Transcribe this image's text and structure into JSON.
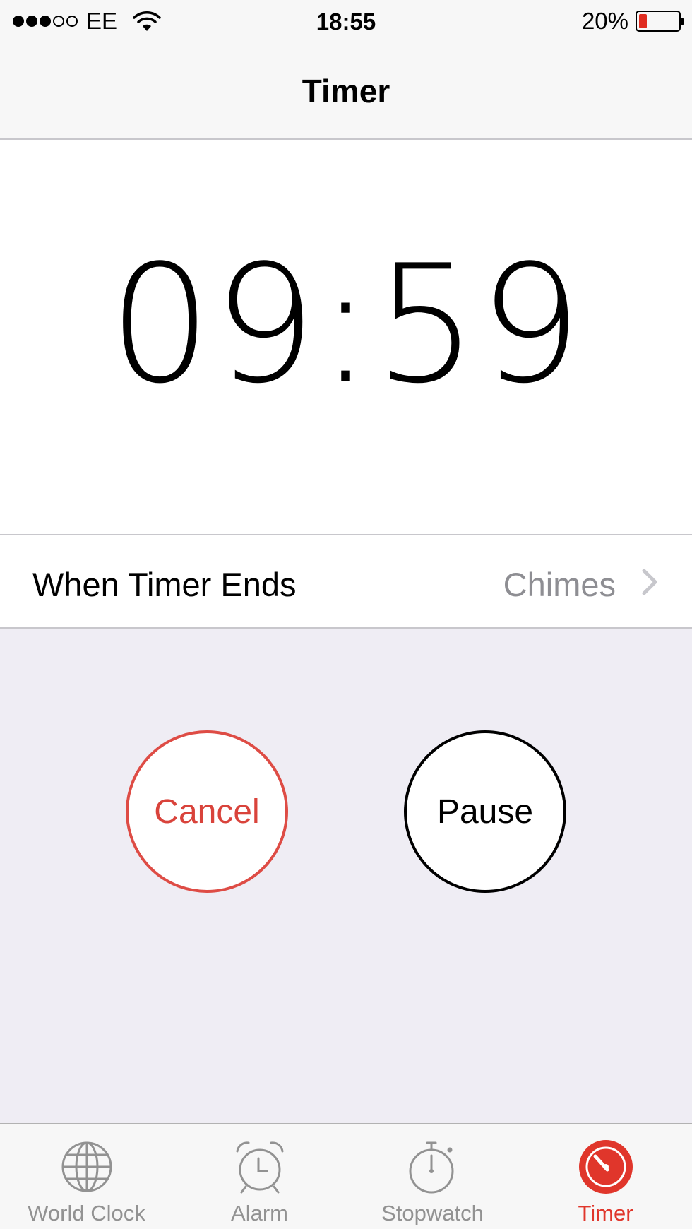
{
  "status_bar": {
    "signal_filled": 3,
    "signal_total": 5,
    "carrier": "EE",
    "time": "18:55",
    "battery_percent_label": "20%",
    "battery_level": 0.2
  },
  "nav": {
    "title": "Timer"
  },
  "timer": {
    "display": "09:59"
  },
  "settings_row": {
    "label": "When Timer Ends",
    "value": "Chimes"
  },
  "buttons": {
    "cancel": "Cancel",
    "pause": "Pause"
  },
  "tabs": [
    {
      "label": "World Clock",
      "icon": "globe-icon",
      "active": false
    },
    {
      "label": "Alarm",
      "icon": "alarm-clock-icon",
      "active": false
    },
    {
      "label": "Stopwatch",
      "icon": "stopwatch-icon",
      "active": false
    },
    {
      "label": "Timer",
      "icon": "timer-icon",
      "active": true
    }
  ],
  "colors": {
    "accent_red": "#e0362b",
    "cancel_red": "#de4c45",
    "inactive_gray": "#929292",
    "controls_background": "#efedf4",
    "secondary_text": "#8e8e93"
  }
}
